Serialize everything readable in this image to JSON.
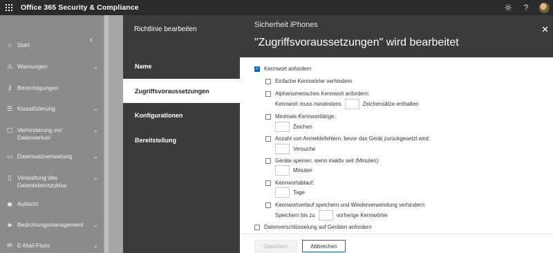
{
  "app": {
    "title": "Office 365 Security & Compliance"
  },
  "topbar": {
    "settings_icon": "gear-icon",
    "help_label": "?",
    "avatar_icon": "avatar"
  },
  "sidebar": {
    "items": [
      {
        "label": "Start",
        "icon": "home-icon"
      },
      {
        "label": "Warnungen",
        "icon": "warning-icon",
        "expandable": true
      },
      {
        "label": "Berechtigungen",
        "icon": "key-icon"
      },
      {
        "label": "Klassifizierung",
        "icon": "list-icon",
        "expandable": true
      },
      {
        "label_line1": "Verhinderung vor",
        "label_line2": "Datenverlust",
        "icon": "shield-doc-icon",
        "expandable": true
      },
      {
        "label": "Datensatzverwaltung",
        "icon": "folder-icon",
        "expandable": true
      },
      {
        "label_line1": "Verwaltung des",
        "label_line2": "Datenlebenszyklus",
        "icon": "lifecycle-icon",
        "expandable": true
      },
      {
        "label": "Aufsicht",
        "icon": "eye-icon"
      },
      {
        "label": "Bedrohungsmanagement",
        "icon": "threat-icon",
        "expandable": true
      },
      {
        "label": "E-Mail-Fluss",
        "icon": "mail-icon",
        "expandable": true
      }
    ]
  },
  "wizard": {
    "panel_title": "Richtlinie bearbeiten",
    "steps": [
      {
        "label": "Name",
        "active": false
      },
      {
        "label": "Zugriffsvoraussetzungen",
        "active": true
      },
      {
        "label": "Konfigurationen",
        "active": false
      },
      {
        "label": "Bereitstellung",
        "active": false
      }
    ]
  },
  "main": {
    "subtitle": "Sicherheit iPhones",
    "title": "\"Zugriffsvoraussetzungen\" wird bearbeitet",
    "require_password": {
      "label": "Kennwort anfordern",
      "checked": true
    },
    "options": {
      "simple_pw": "Einfache Kennwörter verhindern",
      "alnum_pw": "Alphanumerisches Kennwort anfordern:",
      "alnum_prefix": "Kennwort muss mindestens",
      "alnum_suffix": "Zeichensätze enthalten",
      "min_length": "Minimale Kennwortlänge:",
      "min_length_unit": "Zeichen",
      "failed_attempts": "Anzahl von Anmeldefehlern, bevor das Gerät zurückgesetzt wird:",
      "failed_attempts_unit": "Versuche",
      "lock_inactive": "Geräte sperren, wenn inaktiv seit (Minuten):",
      "lock_inactive_unit": "Minuten",
      "expiration": "Kennwortablauf:",
      "expiration_unit": "Tage",
      "history": "Kennwortverlauf speichern und Wiederverwendung verhindern:",
      "history_prefix": "Speichern bis zu",
      "history_suffix": "vorherige Kennwörter"
    },
    "encryption": "Datenverschlüsselung auf Geräten anfordern"
  },
  "footer": {
    "save_label": "Speichern",
    "cancel_label": "Abbrechen"
  },
  "colors": {
    "accent": "#0f6cbd",
    "dark_panel": "#3b3b3b",
    "topbar": "#2b2b2b"
  }
}
